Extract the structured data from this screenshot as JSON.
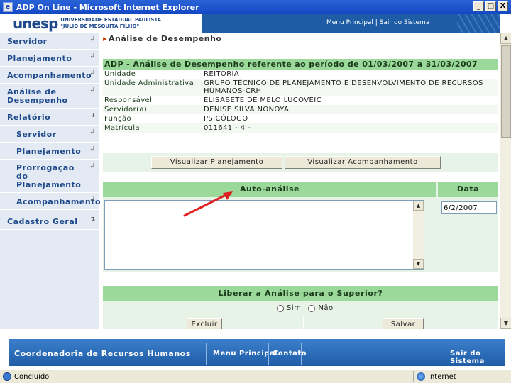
{
  "window": {
    "title": "ADP On Line - Microsoft Internet Explorer",
    "buttons": [
      "_",
      "□",
      "X"
    ]
  },
  "banner": {
    "logo_mark": "unesp",
    "university_line1": "UNIVERSIDADE ESTADUAL PAULISTA",
    "university_line2": "\"JÚLIO DE MESQUITA FILHO\"",
    "top_links": "Menu Principal | Sair do Sistema"
  },
  "sidebar": {
    "items": [
      {
        "label": "Servidor"
      },
      {
        "label": "Planejamento"
      },
      {
        "label": "Acompanhamento"
      },
      {
        "label": "Análise de Desempenho"
      },
      {
        "label": "Relatório"
      },
      {
        "label": "Servidor"
      },
      {
        "label": "Planejamento"
      },
      {
        "label": "Prorrogação do Planejamento"
      },
      {
        "label": "Acompanhamento"
      },
      {
        "label": "Cadastro Geral"
      }
    ]
  },
  "main": {
    "page_title": "Análise de Desempenho",
    "info_header": "ADP - Análise de Desempenho referente ao período de 01/03/2007 a 31/03/2007",
    "fields": [
      {
        "label": "Unidade",
        "value": "REITORIA"
      },
      {
        "label": "Unidade Administrativa",
        "value": "GRUPO TÉCNICO DE PLANEJAMENTO E DESENVOLVIMENTO DE RECURSOS HUMANOS-CRH"
      },
      {
        "label": "Responsável",
        "value": "ELISABETE DE MELO LUCOVEIC"
      },
      {
        "label": "Servidor(a)",
        "value": "DENISE SILVA NONOYA"
      },
      {
        "label": "Função",
        "value": "PSICÓLOGO"
      },
      {
        "label": "Matrícula",
        "value": "011641 - 4 -"
      }
    ],
    "btn_view_plan": "Visualizar Planejamento",
    "btn_view_follow": "Visualizar Acompanhamento",
    "auto_header": "Auto-análise",
    "date_header": "Data",
    "auto_text": "",
    "date_value": "6/2/2007",
    "liberar_header": "Liberar a Análise para o Superior?",
    "radio_yes": "Sim",
    "radio_no": "Não",
    "btn_delete": "Excluir",
    "btn_save": "Salvar"
  },
  "footer": {
    "org": "Coordenadoria de Recursos Humanos",
    "menu": "Menu Principal",
    "contact": "Contato",
    "exit": "Sair do Sistema"
  },
  "status": {
    "left": "Concluído",
    "zone": "Internet"
  },
  "colors": {
    "header_green": "#9bd99b",
    "panel_green": "#e6f3e6",
    "brand_blue": "#1f5ca6",
    "annotation_red": "#e02020"
  }
}
